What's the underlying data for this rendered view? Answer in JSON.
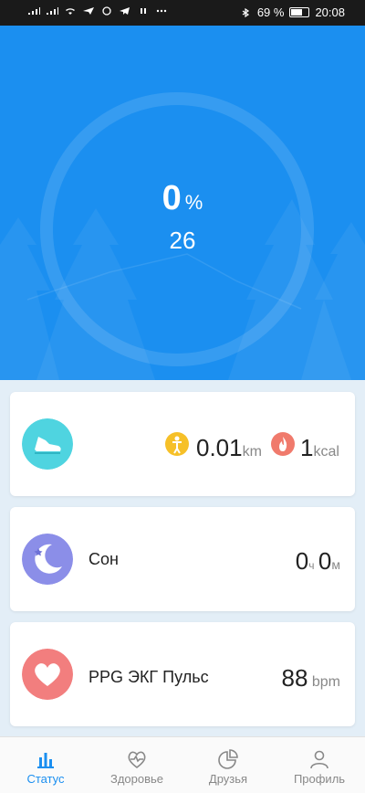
{
  "status_bar": {
    "battery": "69 %",
    "time": "20:08"
  },
  "dashboard": {
    "percent": "0",
    "percent_symbol": "%",
    "steps": "26"
  },
  "activity_card": {
    "distance": "0.01",
    "distance_unit": "km",
    "calories": "1",
    "calories_unit": "kcal"
  },
  "sleep_card": {
    "label": "Сон",
    "hours": "0",
    "hours_unit": "ч",
    "minutes": "0",
    "minutes_unit": "м"
  },
  "heart_card": {
    "label": "PPG ЭКГ Пульс",
    "value": "88",
    "unit": "bpm"
  },
  "tabs": [
    {
      "label": "Статус",
      "icon": "bar-chart-icon",
      "active": true
    },
    {
      "label": "Здоровье",
      "icon": "heart-pulse-icon",
      "active": false
    },
    {
      "label": "Друзья",
      "icon": "pie-chart-icon",
      "active": false
    },
    {
      "label": "Профиль",
      "icon": "person-icon",
      "active": false
    }
  ],
  "colors": {
    "accent": "#1b8ff0",
    "activity_icon": "#4fd4e0",
    "distance_badge": "#f6c028",
    "calories_badge": "#f07a6c",
    "sleep_icon": "#8b8ee8",
    "heart_icon": "#f27e7e"
  }
}
